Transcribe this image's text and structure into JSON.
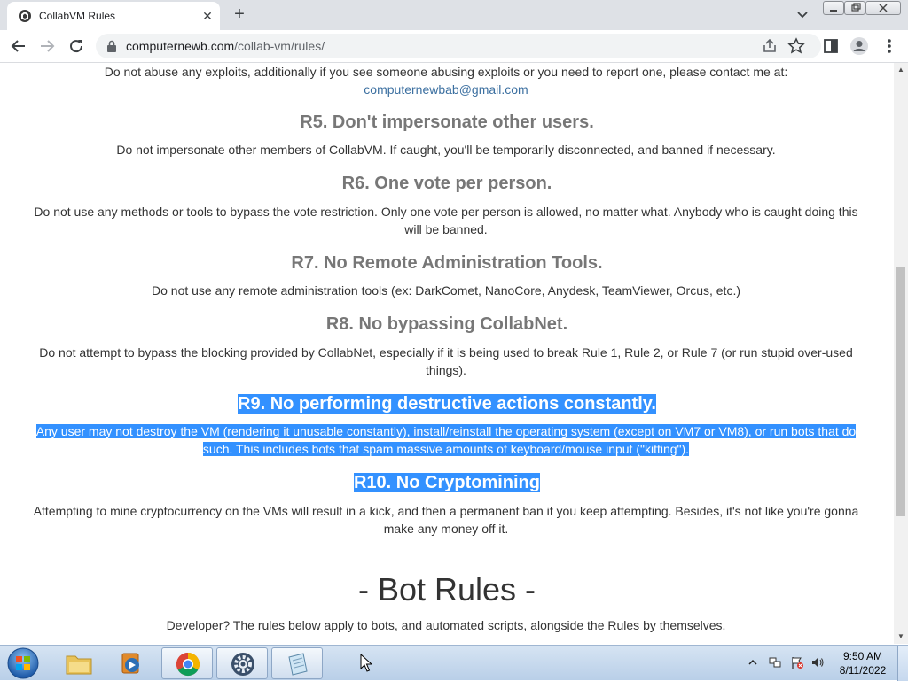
{
  "browser": {
    "tab_title": "CollabVM Rules",
    "url_host": "computernewb.com",
    "url_path": "/collab-vm/rules/"
  },
  "page": {
    "r4_text": "Do not abuse any exploits, additionally if you see someone abusing exploits or you need to report one, please contact me at:",
    "r4_email": "computernewbab@gmail.com",
    "r5_title": "R5. Don't impersonate other users.",
    "r5_text": "Do not impersonate other members of CollabVM. If caught, you'll be temporarily disconnected, and banned if necessary.",
    "r6_title": "R6. One vote per person.",
    "r6_text_1": "Do not use any methods or tools to bypass the vote restriction. Only one vote per person is allowed, no matter what. Anybody who is caught doing this",
    "r6_text_2": "will be banned.",
    "r7_title": "R7. No Remote Administration Tools.",
    "r7_text": "Do not use any remote administration tools (ex: DarkComet, NanoCore, Anydesk, TeamViewer, Orcus, etc.)",
    "r8_title": "R8. No bypassing CollabNet.",
    "r8_text_1": "Do not attempt to bypass the blocking provided by CollabNet, especially if it is being used to break Rule 1, Rule 2, or Rule 7 (or run stupid over-used",
    "r8_text_2": "things).",
    "r9_title": "R9. No performing destructive actions constantly.",
    "r9_text_1": "Any user may not destroy the VM (rendering it unusable constantly), install/reinstall the operating system (except on VM7 or VM8), or run bots that do",
    "r9_text_2": "such. This includes bots that spam massive amounts of keyboard/mouse input (\"kitting\").",
    "r10_title": "R10. No Cryptomining",
    "r10_text_1": "Attempting to mine cryptocurrency on the VMs will result in a kick, and then a permanent ban if you keep attempting. Besides, it's not like you're gonna",
    "r10_text_2": "make any money off it.",
    "bot_heading": "- Bot Rules -",
    "bot_text": "Developer? The rules below apply to bots, and automated scripts, alongside the Rules by themselves."
  },
  "taskbar": {
    "time": "9:50 AM",
    "date": "8/11/2022"
  },
  "colors": {
    "selection": "#3391ff",
    "heading": "#777777",
    "body_text": "#333333",
    "link": "#3b6fa0"
  }
}
